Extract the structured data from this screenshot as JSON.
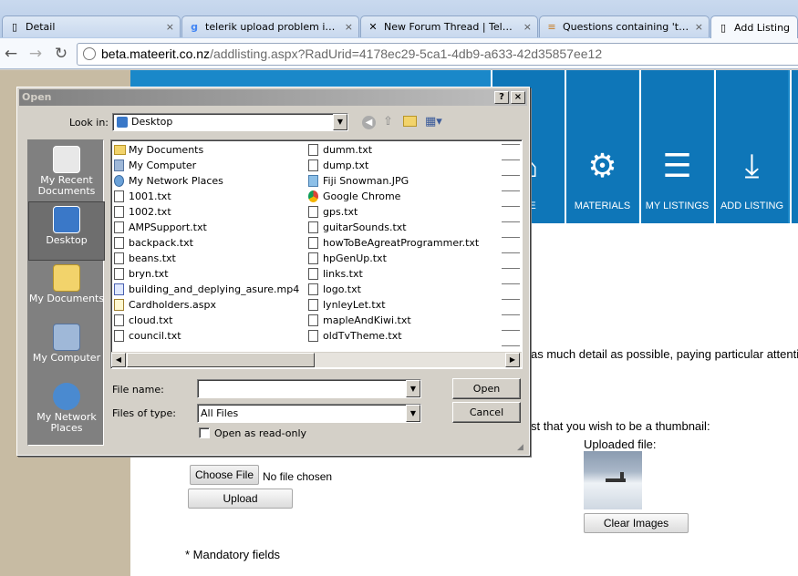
{
  "browser": {
    "tabs": [
      {
        "label": "Detail",
        "icon": "page-icon"
      },
      {
        "label": "telerik upload problem isa fi...",
        "icon": "google-icon"
      },
      {
        "label": "New Forum Thread | Telerik",
        "icon": "telerik-icon"
      },
      {
        "label": "Questions containing 'teleri...",
        "icon": "stack-icon"
      },
      {
        "label": "Add Listing",
        "icon": "page-icon"
      }
    ],
    "close_glyph": "×",
    "url_host": "beta.mateerit.co.nz",
    "url_path": "/addlisting.aspx?RadUrid=4178ec29-5ca1-4db9-a633-42d35857ee12"
  },
  "site_nav": [
    {
      "label": "ME",
      "icon": "home-icon"
    },
    {
      "label": "MATERIALS",
      "icon": "gears-icon"
    },
    {
      "label": "MY LISTINGS",
      "icon": "list-icon"
    },
    {
      "label": "ADD LISTING",
      "icon": "download-icon"
    }
  ],
  "page": {
    "detail_text": "as much detail as possible, paying particular attenti",
    "thumb_text": "st that you wish to be a thumbnail:",
    "uploaded_label": "Uploaded file:",
    "choose_file": "Choose File",
    "no_file": "No file chosen",
    "upload": "Upload",
    "clear_images": "Clear Images",
    "mandatory": "* Mandatory fields"
  },
  "dialog": {
    "title": "Open",
    "help": "?",
    "close": "×",
    "look_in_label": "Look in:",
    "look_in_value": "Desktop",
    "places": [
      {
        "label": "My Recent Documents",
        "icon": "recent-docs-icon"
      },
      {
        "label": "Desktop",
        "icon": "desktop-icon"
      },
      {
        "label": "My Documents",
        "icon": "my-documents-icon"
      },
      {
        "label": "My Computer",
        "icon": "my-computer-icon"
      },
      {
        "label": "My Network Places",
        "icon": "network-icon"
      }
    ],
    "files_col1": [
      "My Documents",
      "My Computer",
      "My Network Places",
      "1001.txt",
      "1002.txt",
      "AMPSupport.txt",
      "backpack.txt",
      "beans.txt",
      "bryn.txt",
      "building_and_deplying_asure.mp4",
      "Cardholders.aspx",
      "cloud.txt",
      "council.txt"
    ],
    "files_col2": [
      "dumm.txt",
      "dump.txt",
      "Fiji Snowman.JPG",
      "Google Chrome",
      "gps.txt",
      "guitarSounds.txt",
      "howToBeAgreatProgrammer.txt",
      "hpGenUp.txt",
      "links.txt",
      "logo.txt",
      "lynleyLet.txt",
      "mapleAndKiwi.txt",
      "oldTvTheme.txt"
    ],
    "file_name_label": "File name:",
    "file_name_value": "",
    "files_of_type_label": "Files of type:",
    "files_of_type_value": "All Files",
    "read_only_label": "Open as read-only",
    "open_button": "Open",
    "cancel_button": "Cancel"
  }
}
